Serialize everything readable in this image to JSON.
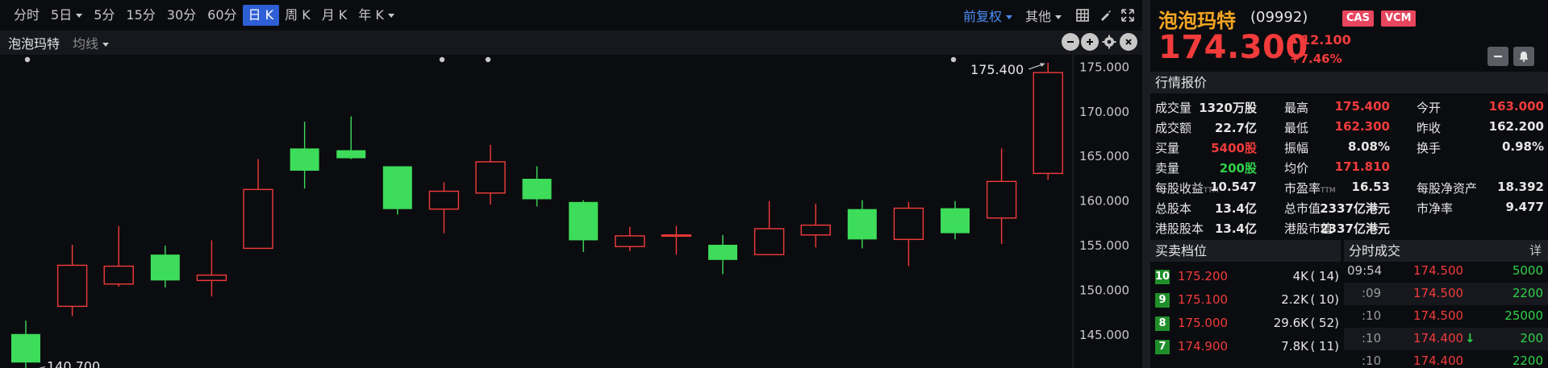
{
  "toolbar": {
    "periods": [
      {
        "label": "分时",
        "active": false,
        "caret": false
      },
      {
        "label": "5日",
        "active": false,
        "caret": true
      },
      {
        "label": "5分",
        "active": false,
        "caret": false
      },
      {
        "label": "15分",
        "active": false,
        "caret": false
      },
      {
        "label": "30分",
        "active": false,
        "caret": false
      },
      {
        "label": "60分",
        "active": false,
        "caret": false
      },
      {
        "label": "日 K",
        "active": true,
        "caret": false
      },
      {
        "label": "周 K",
        "active": false,
        "caret": false
      },
      {
        "label": "月 K",
        "active": false,
        "caret": false
      },
      {
        "label": "年 K",
        "active": false,
        "caret": true
      }
    ],
    "adjust_label": "前复权",
    "other_label": "其他"
  },
  "subbar": {
    "stock_tab": "泡泡玛特",
    "avg_label": "均线"
  },
  "colors": {
    "up": "#f23b3b",
    "down": "#3ddc5a",
    "accent": "#2f5fd6",
    "brand": "#f5a623"
  },
  "chart_data": {
    "type": "candlestick",
    "ylim": [
      142,
      176.3
    ],
    "yticks": [
      "175.000",
      "170.000",
      "165.000",
      "160.000",
      "155.000",
      "150.000",
      "145.000"
    ],
    "ytick_values": [
      175,
      170,
      165,
      160,
      155,
      150,
      145
    ],
    "max_label": "175.400",
    "min_label": "140.700",
    "candles": [
      {
        "o": 145.0,
        "c": 141.8,
        "h": 146.5,
        "l": 140.7
      },
      {
        "o": 148.1,
        "c": 152.7,
        "h": 155.0,
        "l": 147.0
      },
      {
        "o": 150.6,
        "c": 152.6,
        "h": 157.1,
        "l": 150.3
      },
      {
        "o": 153.9,
        "c": 151.0,
        "h": 154.9,
        "l": 150.2
      },
      {
        "o": 151.0,
        "c": 151.6,
        "h": 155.5,
        "l": 149.2
      },
      {
        "o": 154.6,
        "c": 161.2,
        "h": 164.6,
        "l": 154.6
      },
      {
        "o": 165.8,
        "c": 163.3,
        "h": 168.8,
        "l": 161.3
      },
      {
        "o": 165.6,
        "c": 164.7,
        "h": 169.4,
        "l": 164.6
      },
      {
        "o": 163.8,
        "c": 159.0,
        "h": 163.8,
        "l": 158.4
      },
      {
        "o": 159.0,
        "c": 161.0,
        "h": 162.0,
        "l": 156.3
      },
      {
        "o": 160.8,
        "c": 164.3,
        "h": 166.2,
        "l": 159.5
      },
      {
        "o": 162.4,
        "c": 160.1,
        "h": 163.8,
        "l": 159.3
      },
      {
        "o": 159.8,
        "c": 155.5,
        "h": 160.0,
        "l": 154.2
      },
      {
        "o": 154.8,
        "c": 156.0,
        "h": 157.0,
        "l": 154.3
      },
      {
        "o": 156.1,
        "c": 156.1,
        "h": 157.1,
        "l": 153.9
      },
      {
        "o": 155.0,
        "c": 153.3,
        "h": 156.1,
        "l": 151.7
      },
      {
        "o": 153.9,
        "c": 156.8,
        "h": 159.9,
        "l": 153.9
      },
      {
        "o": 156.1,
        "c": 157.2,
        "h": 159.6,
        "l": 154.7
      },
      {
        "o": 159.0,
        "c": 155.6,
        "h": 160.0,
        "l": 154.6
      },
      {
        "o": 155.6,
        "c": 159.1,
        "h": 159.8,
        "l": 152.6
      },
      {
        "o": 159.1,
        "c": 156.3,
        "h": 159.9,
        "l": 155.6
      },
      {
        "o": 158.0,
        "c": 162.1,
        "h": 165.8,
        "l": 155.1
      },
      {
        "o": 163.0,
        "c": 174.3,
        "h": 175.4,
        "l": 162.3
      }
    ]
  },
  "quote": {
    "name": "泡泡玛特",
    "code": "(09992)",
    "tags": [
      "CAS",
      "VCM"
    ],
    "price": "174.300",
    "change": "12.100",
    "pct": "+7.46%",
    "section_title": "行情报价",
    "stats": [
      [
        {
          "label": "成交量",
          "value": "1320万股",
          "color": "white"
        },
        {
          "label": "最高",
          "value": "175.400",
          "color": "red"
        },
        {
          "label": "今开",
          "value": "163.000",
          "color": "red"
        }
      ],
      [
        {
          "label": "成交额",
          "value": "22.7亿",
          "color": "white"
        },
        {
          "label": "最低",
          "value": "162.300",
          "color": "red"
        },
        {
          "label": "昨收",
          "value": "162.200",
          "color": "white"
        }
      ],
      [
        {
          "label": "买量",
          "value": "5400股",
          "color": "red"
        },
        {
          "label": "振幅",
          "value": "8.08%",
          "color": "white"
        },
        {
          "label": "换手",
          "value": "0.98%",
          "color": "white"
        }
      ],
      [
        {
          "label": "卖量",
          "value": "200股",
          "color": "green"
        },
        {
          "label": "均价",
          "value": "171.810",
          "color": "red"
        },
        {
          "label": "",
          "value": "",
          "color": "white"
        }
      ],
      [
        {
          "label": "每股收益",
          "ttm": "TTM",
          "value": "10.547",
          "color": "white"
        },
        {
          "label": "市盈率",
          "ttm": "TTM",
          "value": "16.53",
          "color": "white"
        },
        {
          "label": "每股净资产",
          "value": "18.392",
          "color": "white"
        }
      ],
      [
        {
          "label": "总股本",
          "value": "13.4亿",
          "color": "white"
        },
        {
          "label": "总市值",
          "value": "2337亿港元",
          "color": "white"
        },
        {
          "label": "市净率",
          "value": "9.477",
          "color": "white"
        }
      ],
      [
        {
          "label": "港股股本",
          "value": "13.4亿",
          "color": "white"
        },
        {
          "label": "港股市值",
          "value": "2337亿港元",
          "color": "white"
        },
        {
          "label": "",
          "value": "",
          "color": "white"
        }
      ]
    ]
  },
  "bidask": {
    "title": "买卖档位",
    "rows": [
      {
        "level": "10",
        "price": "175.200",
        "vol": "4K",
        "count": "( 14)"
      },
      {
        "level": "9",
        "price": "175.100",
        "vol": "2.2K",
        "count": "( 10)"
      },
      {
        "level": "8",
        "price": "175.000",
        "vol": "29.6K",
        "count": "( 52)"
      },
      {
        "level": "7",
        "price": "174.900",
        "vol": "7.8K",
        "count": "( 11)"
      }
    ]
  },
  "ticks": {
    "title": "分时成交",
    "detail": "详",
    "rows": [
      {
        "time": "09:54",
        "price": "174.500",
        "vol": "5000",
        "down": false
      },
      {
        "time": ":09",
        "price": "174.500",
        "vol": "2200",
        "down": false
      },
      {
        "time": ":10",
        "price": "174.500",
        "vol": "25000",
        "down": false
      },
      {
        "time": ":10",
        "price": "174.400",
        "vol": "200",
        "down": true
      },
      {
        "time": ":10",
        "price": "174.400",
        "vol": "2200",
        "down": false
      }
    ]
  }
}
